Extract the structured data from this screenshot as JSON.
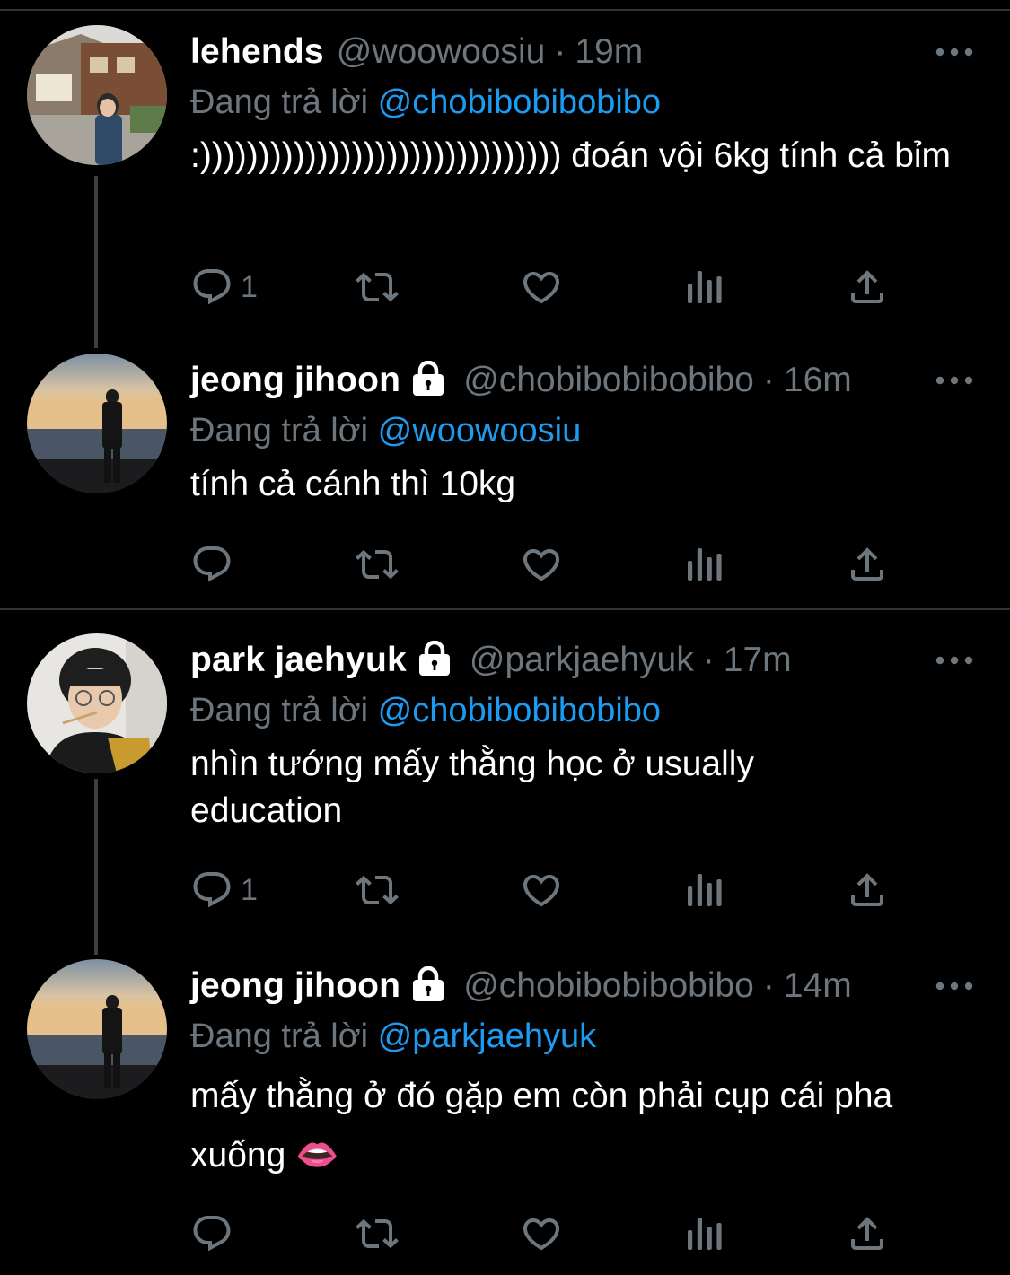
{
  "reply_prefix": "Đang trả lời",
  "tweets": [
    {
      "name": "lehends",
      "locked": false,
      "handle": "@woowoosiu",
      "separator": "·",
      "time": "19m",
      "reply_to": "@chobibobibobibo",
      "text": ":))))))))))))))))))))))))))))))) đoán vội 6kg tính cả bỉm",
      "reply_count": "1",
      "avatar": "lehends-street-photo"
    },
    {
      "name": "jeong jihoon",
      "locked": true,
      "handle": "@chobibobibobibo",
      "separator": "·",
      "time": "16m",
      "reply_to": "@woowoosiu",
      "text": "tính cả cánh thì 10kg",
      "reply_count": "",
      "avatar": "jihoon-seaside-photo"
    },
    {
      "name": "park jaehyuk",
      "locked": true,
      "handle": "@parkjaehyuk",
      "separator": "·",
      "time": "17m",
      "reply_to": "@chobibobibobibo",
      "text": "nhìn tướng mấy thằng học ở usually education",
      "reply_count": "1",
      "avatar": "jaehyuk-portrait-photo"
    },
    {
      "name": "jeong jihoon",
      "locked": true,
      "handle": "@chobibobibobibo",
      "separator": "·",
      "time": "14m",
      "reply_to": "@parkjaehyuk",
      "text": "mấy thằng ở đó gặp em còn phải cụp cái pha xuống 👄",
      "reply_count": "",
      "avatar": "jihoon-seaside-photo"
    }
  ],
  "colors": {
    "background": "#000000",
    "secondary_text": "#6e767d",
    "link": "#1d9bf0",
    "divider": "#2f3336"
  },
  "icons": [
    "reply-icon",
    "retweet-icon",
    "like-icon",
    "views-icon",
    "share-icon",
    "more-icon",
    "lock-icon"
  ]
}
